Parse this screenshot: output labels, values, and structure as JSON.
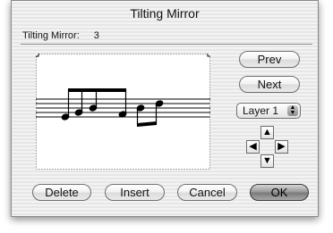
{
  "window": {
    "title": "Tilting Mirror"
  },
  "info": {
    "label": "Tilting Mirror:",
    "value": "3"
  },
  "buttons": {
    "prev": "Prev",
    "next": "Next",
    "delete": "Delete",
    "insert": "Insert",
    "cancel": "Cancel",
    "ok": "OK"
  },
  "layer_select": {
    "selected": "Layer 1"
  },
  "nudge_arrows": {
    "up": "▲",
    "left": "◀",
    "right": "▶",
    "down": "▼"
  },
  "icons": {
    "popup": "updown-arrows-icon"
  }
}
